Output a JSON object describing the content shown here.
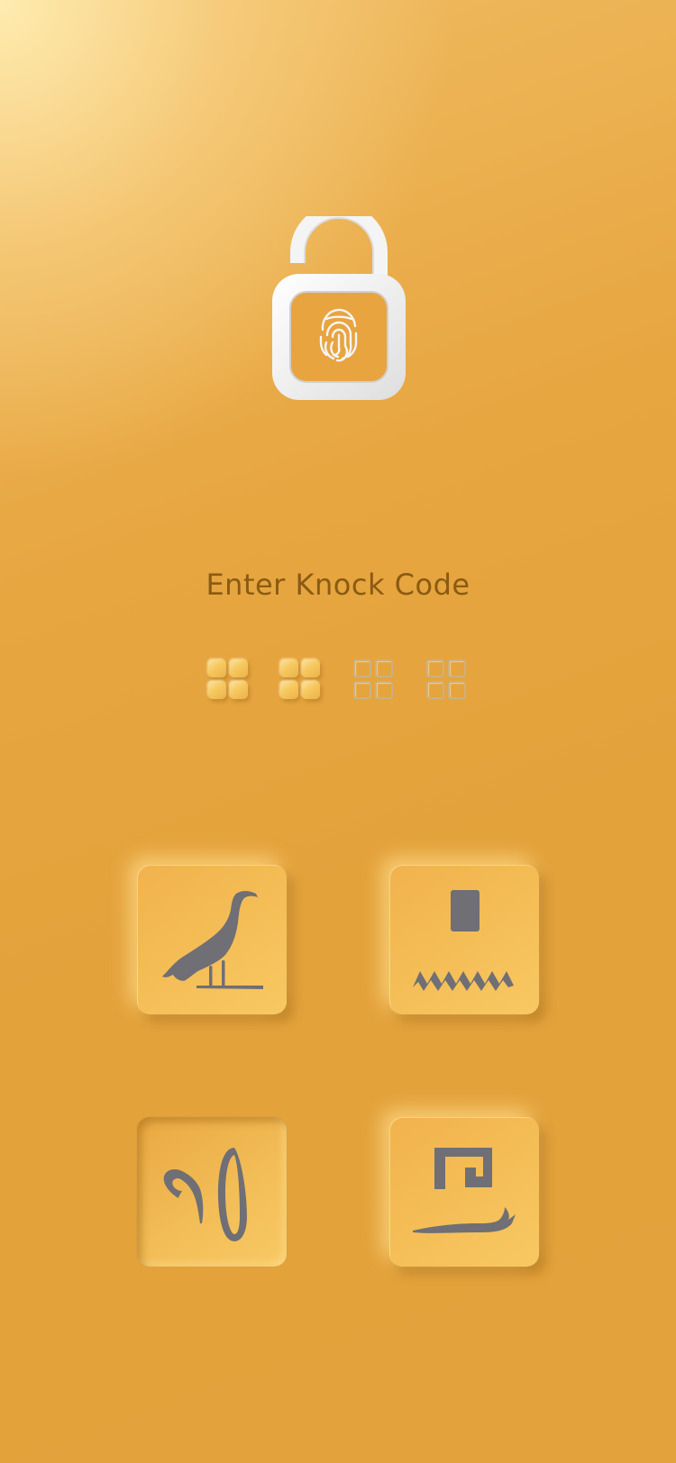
{
  "lock": {
    "icon": "unlocked-padlock-fingerprint-icon"
  },
  "title": "Enter Knock Code",
  "code_progress": {
    "total": 4,
    "entered": 2
  },
  "keys": [
    {
      "icon": "ibis-hieroglyph-icon",
      "state": "raised"
    },
    {
      "icon": "water-hieroglyph-icon",
      "state": "raised"
    },
    {
      "icon": "reed-hieroglyph-icon",
      "state": "pressed"
    },
    {
      "icon": "cobra-hieroglyph-icon",
      "state": "raised"
    }
  ],
  "colors": {
    "background": "#e4a23b",
    "title_text": "#8a5b12",
    "glyph": "#6f6f75",
    "lock": "#f2f2f2"
  }
}
